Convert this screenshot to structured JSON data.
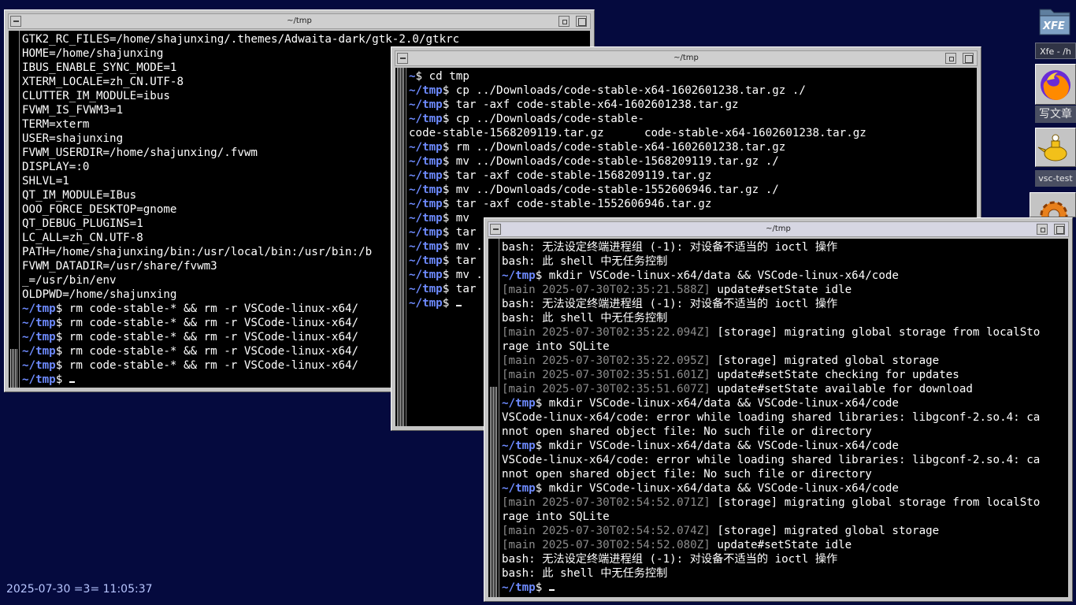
{
  "windows": {
    "left": {
      "title": "~/tmp",
      "lines": [
        [
          [
            "GTK2_RC_FILES=/home/shajunxing/.themes/Adwaita-dark/gtk-2.0/gtkrc",
            ""
          ]
        ],
        [
          [
            "HOME=/home/shajunxing",
            ""
          ]
        ],
        [
          [
            "IBUS_ENABLE_SYNC_MODE=1",
            ""
          ]
        ],
        [
          [
            "XTERM_LOCALE=zh_CN.UTF-8",
            ""
          ]
        ],
        [
          [
            "CLUTTER_IM_MODULE=ibus",
            ""
          ]
        ],
        [
          [
            "FVWM_IS_FVWM3=1",
            ""
          ]
        ],
        [
          [
            "TERM=xterm",
            ""
          ]
        ],
        [
          [
            "USER=shajunxing",
            ""
          ]
        ],
        [
          [
            "FVWM_USERDIR=/home/shajunxing/.fvwm",
            ""
          ]
        ],
        [
          [
            "DISPLAY=:0",
            ""
          ]
        ],
        [
          [
            "SHLVL=1",
            ""
          ]
        ],
        [
          [
            "QT_IM_MODULE=IBus",
            ""
          ]
        ],
        [
          [
            "OOO_FORCE_DESKTOP=gnome",
            ""
          ]
        ],
        [
          [
            "QT_DEBUG_PLUGINS=1",
            ""
          ]
        ],
        [
          [
            "LC_ALL=zh_CN.UTF-8",
            ""
          ]
        ],
        [
          [
            "PATH=/home/shajunxing/bin:/usr/local/bin:/usr/bin:/b",
            ""
          ]
        ],
        [
          [
            "FVWM_DATADIR=/usr/share/fvwm3",
            ""
          ]
        ],
        [
          [
            "_=/usr/bin/env",
            ""
          ]
        ],
        [
          [
            "OLDPWD=/home/shajunxing",
            ""
          ]
        ],
        [
          [
            "~/tmp",
            "p"
          ],
          [
            "$ rm code-stable-* && rm -r VSCode-linux-x64/",
            ""
          ]
        ],
        [
          [
            "~/tmp",
            "p"
          ],
          [
            "$ rm code-stable-* && rm -r VSCode-linux-x64/",
            ""
          ]
        ],
        [
          [
            "~/tmp",
            "p"
          ],
          [
            "$ rm code-stable-* && rm -r VSCode-linux-x64/",
            ""
          ]
        ],
        [
          [
            "~/tmp",
            "p"
          ],
          [
            "$ rm code-stable-* && rm -r VSCode-linux-x64/",
            ""
          ]
        ],
        [
          [
            "~/tmp",
            "p"
          ],
          [
            "$ rm code-stable-* && rm -r VSCode-linux-x64/",
            ""
          ]
        ],
        [
          [
            "~/tmp",
            "p"
          ],
          [
            "$ ",
            ""
          ]
        ]
      ]
    },
    "middle": {
      "title": "~/tmp",
      "lines": [
        [
          [
            "~",
            "p"
          ],
          [
            "$ cd tmp",
            ""
          ]
        ],
        [
          [
            "~/tmp",
            "p"
          ],
          [
            "$ cp ../Downloads/code-stable-x64-1602601238.tar.gz ./",
            ""
          ]
        ],
        [
          [
            "~/tmp",
            "p"
          ],
          [
            "$ tar -axf code-stable-x64-1602601238.tar.gz",
            ""
          ]
        ],
        [
          [
            "~/tmp",
            "p"
          ],
          [
            "$ cp ../Downloads/code-stable-",
            ""
          ]
        ],
        [
          [
            "code-stable-1568209119.tar.gz      code-stable-x64-1602601238.tar.gz",
            ""
          ]
        ],
        [
          [
            "~/tmp",
            "p"
          ],
          [
            "$ rm ../Downloads/code-stable-x64-1602601238.tar.gz",
            ""
          ]
        ],
        [
          [
            "~/tmp",
            "p"
          ],
          [
            "$ mv ../Downloads/code-stable-1568209119.tar.gz ./",
            ""
          ]
        ],
        [
          [
            "~/tmp",
            "p"
          ],
          [
            "$ tar -axf code-stable-1568209119.tar.gz",
            ""
          ]
        ],
        [
          [
            "~/tmp",
            "p"
          ],
          [
            "$ mv ../Downloads/code-stable-1552606946.tar.gz ./",
            ""
          ]
        ],
        [
          [
            "~/tmp",
            "p"
          ],
          [
            "$ tar -axf code-stable-1552606946.tar.gz",
            ""
          ]
        ],
        [
          [
            "~/tmp",
            "p"
          ],
          [
            "$ mv ",
            ""
          ]
        ],
        [
          [
            "~/tmp",
            "p"
          ],
          [
            "$ tar",
            ""
          ]
        ],
        [
          [
            "~/tmp",
            "p"
          ],
          [
            "$ mv .",
            ""
          ]
        ],
        [
          [
            "~/tmp",
            "p"
          ],
          [
            "$ tar",
            ""
          ]
        ],
        [
          [
            "~/tmp",
            "p"
          ],
          [
            "$ mv .",
            ""
          ]
        ],
        [
          [
            "~/tmp",
            "p"
          ],
          [
            "$ tar",
            ""
          ]
        ],
        [
          [
            "~/tmp",
            "p"
          ],
          [
            "$ ",
            ""
          ]
        ]
      ]
    },
    "right": {
      "title": "~/tmp",
      "lines": [
        [
          [
            "bash: 无法设定终端进程组 (-1): 对设备不适当的 ioctl 操作",
            ""
          ]
        ],
        [
          [
            "bash: 此 shell 中无任务控制",
            ""
          ]
        ],
        [
          [
            "~/tmp",
            "p"
          ],
          [
            "$ mkdir VSCode-linux-x64/data && VSCode-linux-x64/code",
            ""
          ]
        ],
        [
          [
            "[main 2025-07-30T02:35:21.588Z]",
            "g"
          ],
          [
            " update#setState idle",
            ""
          ]
        ],
        [
          [
            "bash: 无法设定终端进程组 (-1): 对设备不适当的 ioctl 操作",
            ""
          ]
        ],
        [
          [
            "bash: 此 shell 中无任务控制",
            ""
          ]
        ],
        [
          [
            "[main 2025-07-30T02:35:22.094Z]",
            "g"
          ],
          [
            " [storage] migrating global storage from localSto",
            ""
          ]
        ],
        [
          [
            "rage into SQLite",
            ""
          ]
        ],
        [
          [
            "[main 2025-07-30T02:35:22.095Z]",
            "g"
          ],
          [
            " [storage] migrated global storage",
            ""
          ]
        ],
        [
          [
            "[main 2025-07-30T02:35:51.601Z]",
            "g"
          ],
          [
            " update#setState checking for updates",
            ""
          ]
        ],
        [
          [
            "[main 2025-07-30T02:35:51.607Z]",
            "g"
          ],
          [
            " update#setState available for download",
            ""
          ]
        ],
        [
          [
            "~/tmp",
            "p"
          ],
          [
            "$ mkdir VSCode-linux-x64/data && VSCode-linux-x64/code",
            ""
          ]
        ],
        [
          [
            "VSCode-linux-x64/code: error while loading shared libraries: libgconf-2.so.4: ca",
            ""
          ]
        ],
        [
          [
            "nnot open shared object file: No such file or directory",
            ""
          ]
        ],
        [
          [
            "~/tmp",
            "p"
          ],
          [
            "$ mkdir VSCode-linux-x64/data && VSCode-linux-x64/code",
            ""
          ]
        ],
        [
          [
            "VSCode-linux-x64/code: error while loading shared libraries: libgconf-2.so.4: ca",
            ""
          ]
        ],
        [
          [
            "nnot open shared object file: No such file or directory",
            ""
          ]
        ],
        [
          [
            "~/tmp",
            "p"
          ],
          [
            "$ mkdir VSCode-linux-x64/data && VSCode-linux-x64/code",
            ""
          ]
        ],
        [
          [
            "[main 2025-07-30T02:54:52.071Z]",
            "g"
          ],
          [
            " [storage] migrating global storage from localSto",
            ""
          ]
        ],
        [
          [
            "rage into SQLite",
            ""
          ]
        ],
        [
          [
            "[main 2025-07-30T02:54:52.074Z]",
            "g"
          ],
          [
            " [storage] migrated global storage",
            ""
          ]
        ],
        [
          [
            "[main 2025-07-30T02:54:52.080Z]",
            "g"
          ],
          [
            " update#setState idle",
            ""
          ]
        ],
        [
          [
            "bash: 无法设定终端进程组 (-1): 对设备不适当的 ioctl 操作",
            ""
          ]
        ],
        [
          [
            "bash: 此 shell 中无任务控制",
            ""
          ]
        ],
        [
          [
            "~/tmp",
            "p"
          ],
          [
            "$ ",
            ""
          ]
        ]
      ]
    }
  },
  "dock": {
    "xfe_label": "XFE",
    "xfe_caption": "Xfe - /h",
    "firefox_caption": "写文章",
    "vsc_caption": "vsc-test"
  },
  "clock": "2025-07-30 =3= 11:05:37",
  "colors": {
    "desktop": "#050a3e",
    "prompt": "#6e8bff",
    "log_prefix": "#8c8c8c"
  }
}
